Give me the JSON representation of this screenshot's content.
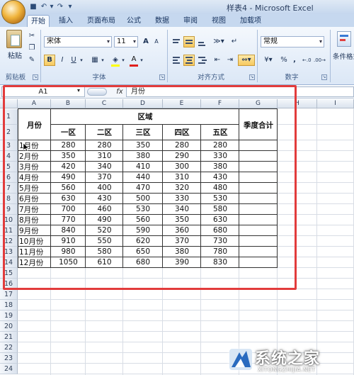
{
  "window": {
    "title": "样表4 - Microsoft Excel"
  },
  "quick_access": [
    {
      "name": "save-icon",
      "glyph": "■"
    },
    {
      "name": "undo-icon",
      "glyph": "↶"
    },
    {
      "name": "undo-dropdown-icon",
      "glyph": "▾"
    },
    {
      "name": "redo-icon",
      "glyph": "↷"
    },
    {
      "name": "customize-qat-icon",
      "glyph": "▾"
    }
  ],
  "tabs": [
    "开始",
    "插入",
    "页面布局",
    "公式",
    "数据",
    "审阅",
    "视图",
    "加载项"
  ],
  "ribbon": {
    "clipboard": {
      "paste_label": "粘贴",
      "group_label": "剪贴板"
    },
    "font": {
      "name": "宋体",
      "size": "11",
      "bold": "B",
      "italic": "I",
      "underline": "U",
      "grow": "A",
      "shrink": "A",
      "font_color": "A",
      "group_label": "字体"
    },
    "alignment": {
      "group_label": "对齐方式"
    },
    "number": {
      "format": "常规",
      "percent": "%",
      "comma": ",",
      "group_label": "数字"
    },
    "styles": {
      "cond_format_label": "条件格式"
    }
  },
  "formula_bar": {
    "name_box": "A1",
    "fx": "fx",
    "value": "月份"
  },
  "columns": [
    "A",
    "B",
    "C",
    "D",
    "E",
    "F",
    "G",
    "H",
    "I"
  ],
  "rows": [
    "1",
    "2",
    "3",
    "4",
    "5",
    "6",
    "7",
    "8",
    "9",
    "10",
    "11",
    "12",
    "13",
    "14",
    "15",
    "16",
    "17",
    "18",
    "19",
    "20",
    "21",
    "22",
    "23",
    "24"
  ],
  "table": {
    "month_header": "月份",
    "region_header": "区域",
    "season_total_header": "季度合计",
    "region_columns": [
      "一区",
      "二区",
      "三区",
      "四区",
      "五区"
    ],
    "data": [
      {
        "month": "1月份",
        "values": [
          "280",
          "280",
          "350",
          "280",
          "280"
        ]
      },
      {
        "month": "2月份",
        "values": [
          "350",
          "310",
          "380",
          "290",
          "330"
        ]
      },
      {
        "month": "3月份",
        "values": [
          "420",
          "340",
          "410",
          "300",
          "380"
        ]
      },
      {
        "month": "4月份",
        "values": [
          "490",
          "370",
          "440",
          "310",
          "430"
        ]
      },
      {
        "month": "5月份",
        "values": [
          "560",
          "400",
          "470",
          "320",
          "480"
        ]
      },
      {
        "month": "6月份",
        "values": [
          "630",
          "430",
          "500",
          "330",
          "530"
        ]
      },
      {
        "month": "7月份",
        "values": [
          "700",
          "460",
          "530",
          "340",
          "580"
        ]
      },
      {
        "month": "8月份",
        "values": [
          "770",
          "490",
          "560",
          "350",
          "630"
        ]
      },
      {
        "month": "9月份",
        "values": [
          "840",
          "520",
          "590",
          "360",
          "680"
        ]
      },
      {
        "month": "10月份",
        "values": [
          "910",
          "550",
          "620",
          "370",
          "730"
        ]
      },
      {
        "month": "11月份",
        "values": [
          "980",
          "580",
          "650",
          "380",
          "780"
        ]
      },
      {
        "month": "12月份",
        "values": [
          "1050",
          "610",
          "680",
          "390",
          "830"
        ]
      }
    ]
  },
  "watermark": {
    "text": "系统之家",
    "url": "XITONGZHIJIA.NET"
  },
  "colors": {
    "highlight": "#e23c3c",
    "ribbon": "#dbe7f6"
  }
}
